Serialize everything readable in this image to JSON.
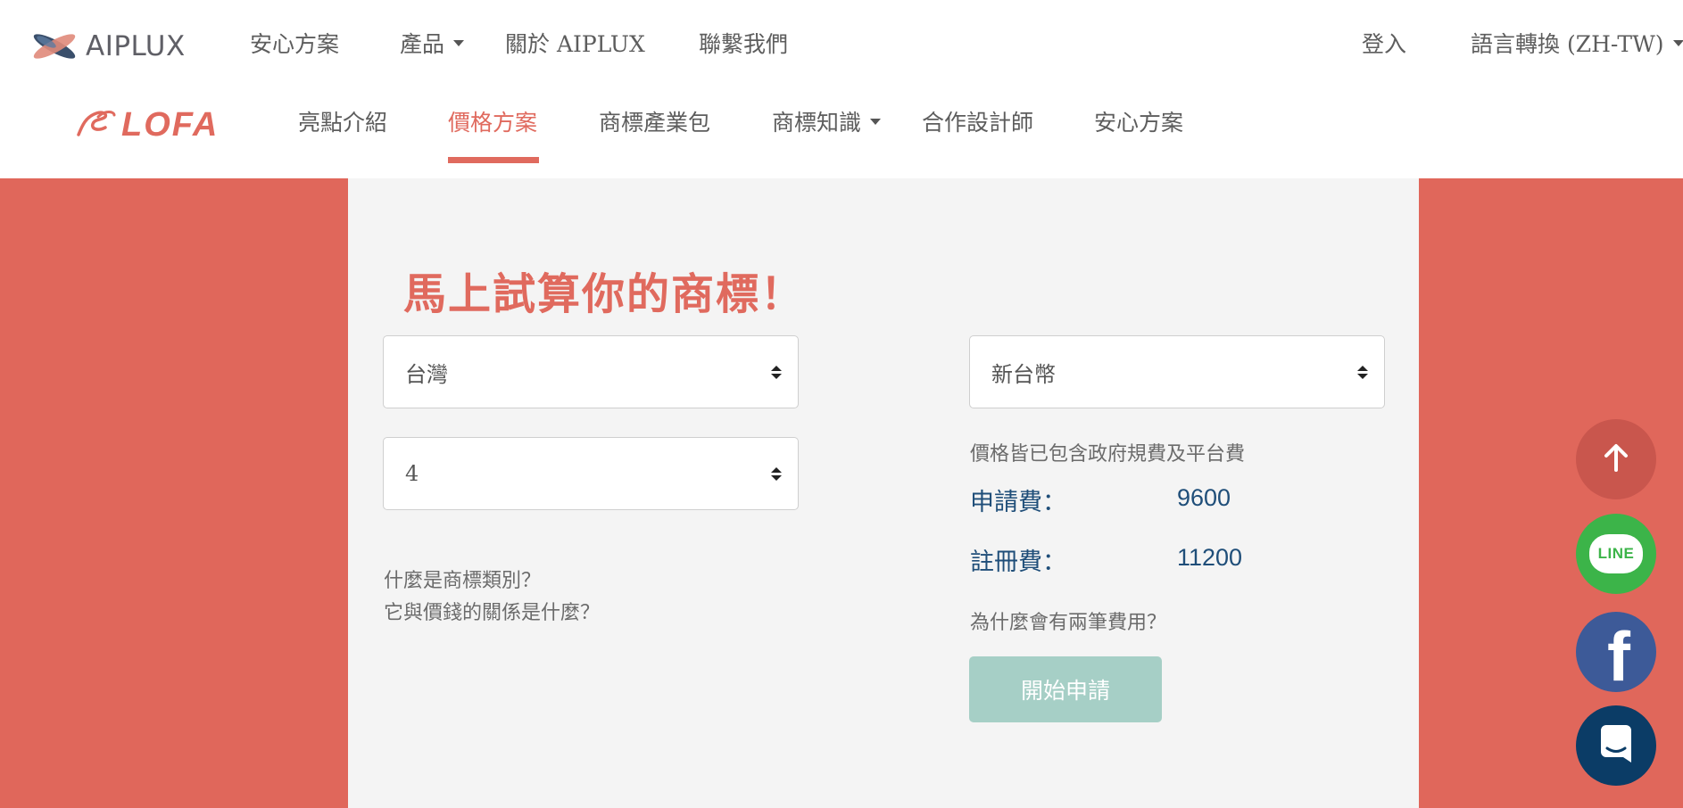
{
  "top_nav": {
    "brand": "AIPLUX",
    "items": [
      {
        "label": "安心方案"
      },
      {
        "label": "產品"
      },
      {
        "label": "關於 AIPLUX"
      },
      {
        "label": "聯繫我們"
      }
    ],
    "login": "登入",
    "language": "語言轉換 (ZH-TW)"
  },
  "sub_nav": {
    "brand": "LOFA",
    "items": [
      {
        "label": "亮點介紹"
      },
      {
        "label": "價格方案"
      },
      {
        "label": "商標產業包"
      },
      {
        "label": "商標知識"
      },
      {
        "label": "合作設計師"
      },
      {
        "label": "安心方案"
      }
    ],
    "active": "價格方案"
  },
  "calculator": {
    "title": "馬上試算你的商標！",
    "country_select": "台灣",
    "class_count_select": "4",
    "currency_select": "新台幣",
    "help_line_1": "什麼是商標類別？",
    "help_line_2": "它與價錢的關係是什麼？",
    "price_note": "價格皆已包含政府規費及平台費",
    "application_fee_label": "申請費：",
    "application_fee_value": "9600",
    "registration_fee_label": "註冊費：",
    "registration_fee_value": "11200",
    "why_two_fees": "為什麼會有兩筆費用？",
    "apply_button": "開始申請"
  },
  "floating": {
    "line_label": "LINE",
    "facebook_label": "f"
  },
  "colors": {
    "accent": "#e06a5e",
    "band": "#e0675b",
    "fee_text": "#1f4e79",
    "apply_button": "#a6cfc6",
    "line_green": "#3cb449",
    "facebook_blue": "#3d5a98",
    "chat_navy": "#0b3c66"
  },
  "icons": [
    "aiplux-logo-icon",
    "lofa-bird-icon",
    "chevron-down-icon",
    "select-arrows-icon",
    "arrow-up-icon",
    "line-icon",
    "facebook-icon",
    "chat-bubble-icon"
  ]
}
